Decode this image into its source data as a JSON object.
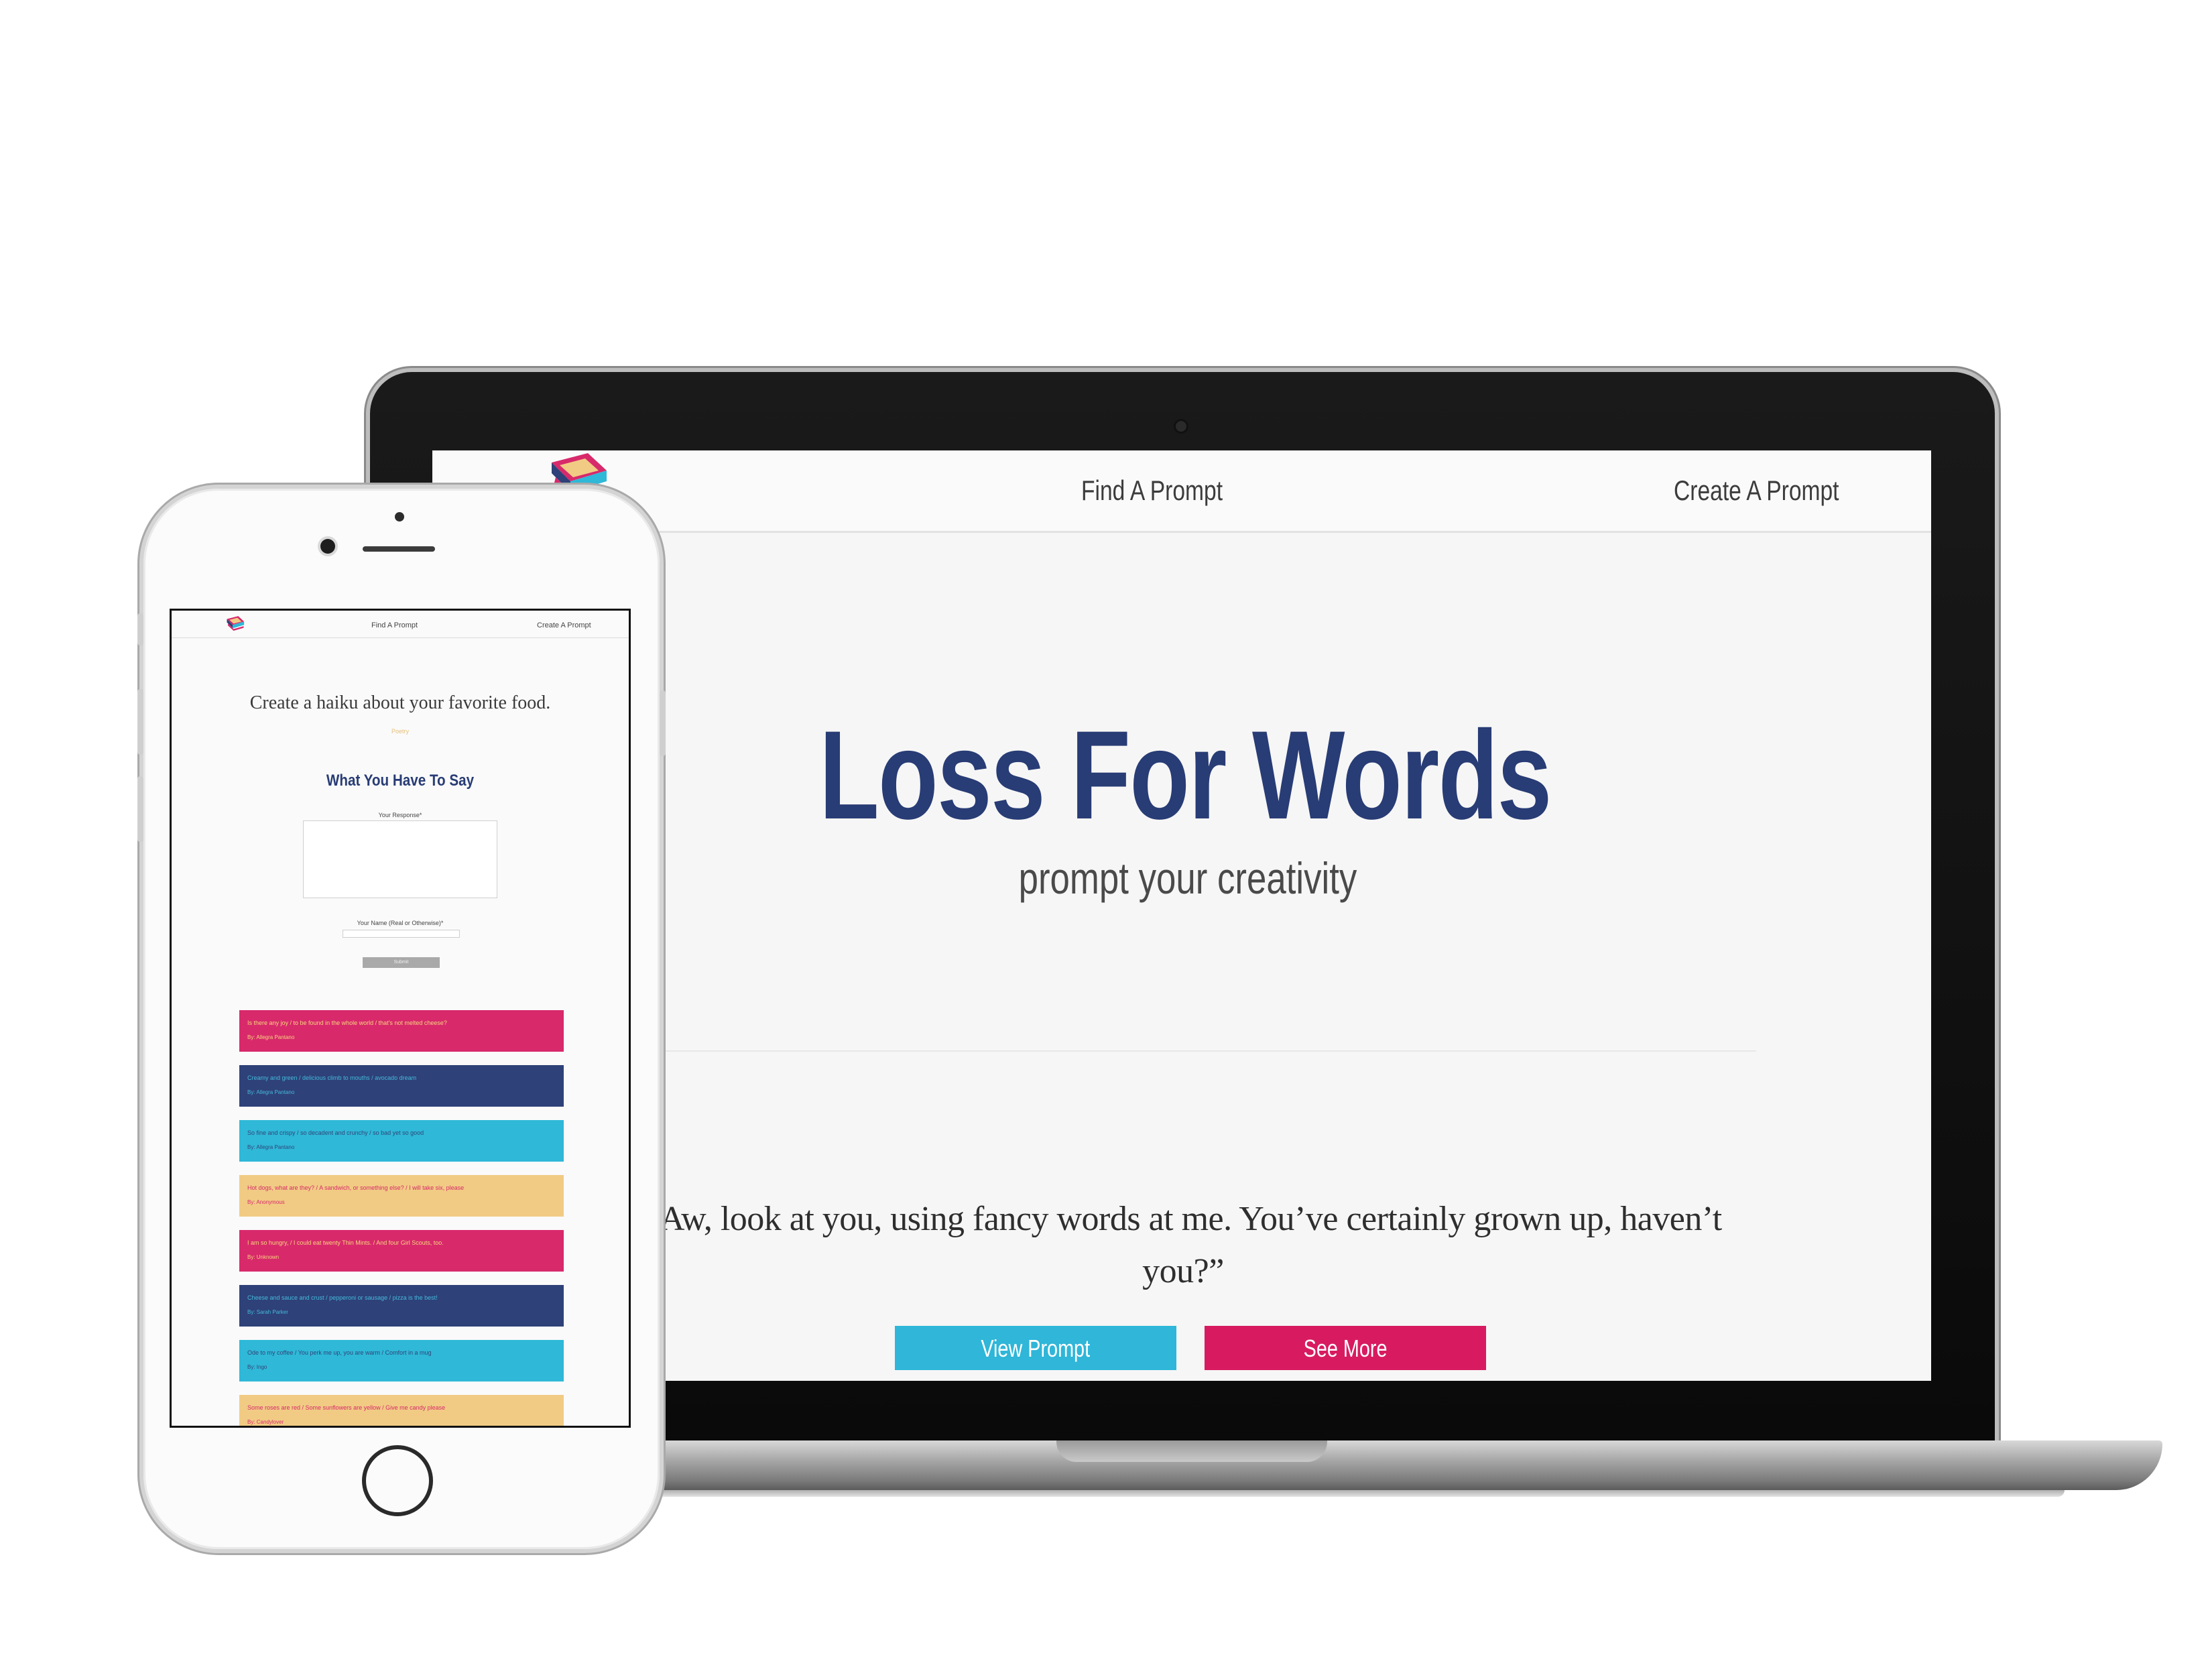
{
  "laptop": {
    "nav": {
      "find_label": "Find A Prompt",
      "create_label": "Create A Prompt"
    },
    "hero": {
      "title": "Loss For Words",
      "subtitle": "prompt your creativity"
    },
    "quote": "“Aw, look at you, using fancy words at me. You’ve certainly grown up, haven’t you?”",
    "buttons": {
      "view_label": "View Prompt",
      "more_label": "See More"
    }
  },
  "phone": {
    "nav": {
      "find_label": "Find A Prompt",
      "create_label": "Create A Prompt"
    },
    "prompt": "Create a haiku about your favorite food.",
    "tag": "Poetry",
    "form": {
      "heading": "What You Have To Say",
      "response_label": "Your Response*",
      "name_label": "Your Name (Real or Otherwise)*",
      "submit_label": "Submit"
    },
    "responses": [
      {
        "text": "Is there any joy / to be found in the whole world / that's not melted cheese?",
        "author": "By: Allegra Pantano",
        "color": "pink"
      },
      {
        "text": "Creamy and green / delicious climb to mouths / avocado dream",
        "author": "By: Allegra Pantano",
        "color": "navy"
      },
      {
        "text": "So fine and crispy / so decadent and crunchy / so bad yet so good",
        "author": "By: Allegra Pantano",
        "color": "cyan"
      },
      {
        "text": "Hot dogs, what are they? / A sandwich, or something else? / I will take six, please",
        "author": "By: Anonymous",
        "color": "gold"
      },
      {
        "text": "I am so hungry, / I could eat twenty Thin Mints. / And four Girl Scouts, too.",
        "author": "By: Unknown",
        "color": "pink"
      },
      {
        "text": "Cheese and sauce and crust / pepperoni or sausage / pizza is the best!",
        "author": "By: Sarah Parker",
        "color": "navy"
      },
      {
        "text": "Ode to my coffee / You perk me up, you are warm / Comfort in a mug",
        "author": "By: Ingo",
        "color": "cyan"
      },
      {
        "text": "Some roses are red / Some sunflowers are yellow / Give me candy please",
        "author": "By: Candylover",
        "color": "gold"
      }
    ]
  },
  "colors": {
    "navy": "#283c75",
    "pink": "#d8296b",
    "cyan": "#2fb8d8",
    "gold": "#f1cb84"
  }
}
